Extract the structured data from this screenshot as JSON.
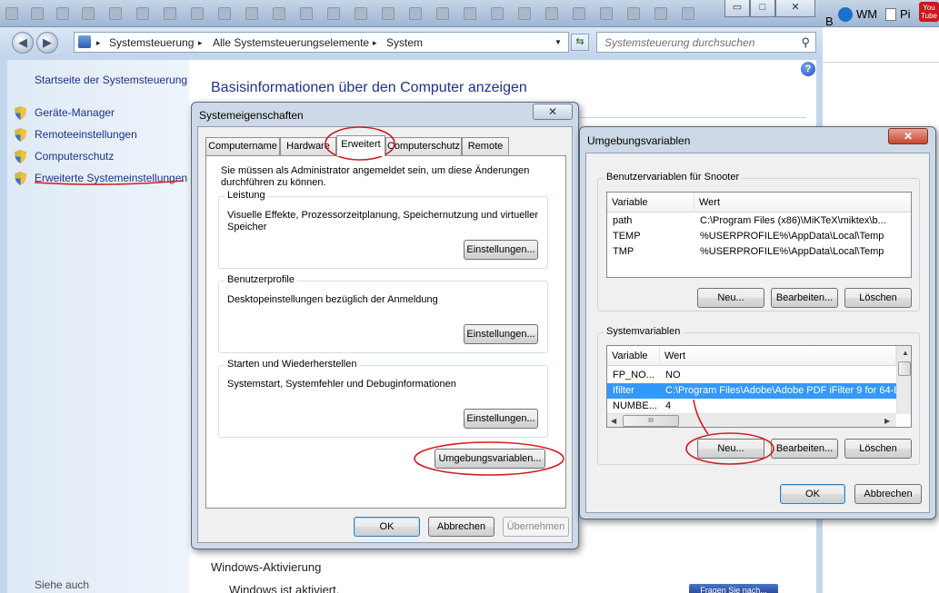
{
  "taskbar": {
    "right_items": [
      "B",
      "WM",
      "Pi",
      "You Tube"
    ]
  },
  "window": {
    "controls": {
      "minimize": "▭",
      "maximize": "□",
      "close": "✕"
    }
  },
  "navbar": {
    "back_icon": "◀",
    "forward_icon": "▶",
    "breadcrumb": [
      "Systemsteuerung",
      "Alle Systemsteuerungselemente",
      "System"
    ],
    "breadcrumb_sep": "▸",
    "search_placeholder": "Systemsteuerung durchsuchen"
  },
  "sidebar": {
    "home": "Startseite der Systemsteuerung",
    "items": [
      {
        "label": "Geräte-Manager"
      },
      {
        "label": "Remoteeinstellungen"
      },
      {
        "label": "Computerschutz"
      },
      {
        "label": "Erweiterte Systemeinstellungen"
      }
    ],
    "see_also": "Siehe auch"
  },
  "content": {
    "headline": "Basisinformationen über den Computer anzeigen",
    "help": "?",
    "activation_heading": "Windows-Aktivierung",
    "activation_status": "Windows ist aktiviert.",
    "fragen_button": "Fragen Sie nach..."
  },
  "sysprops": {
    "title": "Systemeigenschaften",
    "close": "✕",
    "tabs": [
      "Computername",
      "Hardware",
      "Erweitert",
      "Computerschutz",
      "Remote"
    ],
    "active_tab": "Erweitert",
    "admin_note": "Sie müssen als Administrator angemeldet sein, um diese Änderungen durchführen zu können.",
    "groups": [
      {
        "title": "Leistung",
        "desc": "Visuelle Effekte, Prozessorzeitplanung, Speichernutzung und virtueller Speicher",
        "button": "Einstellungen..."
      },
      {
        "title": "Benutzerprofile",
        "desc": "Desktopeinstellungen bezüglich der Anmeldung",
        "button": "Einstellungen..."
      },
      {
        "title": "Starten und Wiederherstellen",
        "desc": "Systemstart, Systemfehler und Debuginformationen",
        "button": "Einstellungen..."
      }
    ],
    "env_button": "Umgebungsvariablen...",
    "ok": "OK",
    "cancel": "Abbrechen",
    "apply": "Übernehmen"
  },
  "envvars": {
    "title": "Umgebungsvariablen",
    "close": "✕",
    "user_group_title": "Benutzervariablen für Snooter",
    "columns": [
      "Variable",
      "Wert"
    ],
    "user_vars": [
      {
        "name": "path",
        "value": "C:\\Program Files (x86)\\MiKTeX\\miktex\\b..."
      },
      {
        "name": "TEMP",
        "value": "%USERPROFILE%\\AppData\\Local\\Temp"
      },
      {
        "name": "TMP",
        "value": "%USERPROFILE%\\AppData\\Local\\Temp"
      }
    ],
    "user_buttons": {
      "new": "Neu...",
      "edit": "Bearbeiten...",
      "delete": "Löschen"
    },
    "system_group_title": "Systemvariablen",
    "system_vars": [
      {
        "name": "FP_NO...",
        "value": "NO"
      },
      {
        "name": "Ifilter",
        "value": "C:\\Program Files\\Adobe\\Adobe PDF iFilter 9 for 64-b"
      },
      {
        "name": "NUMBE...",
        "value": "4"
      }
    ],
    "selected_system_row": 1,
    "hscroll_thumb": "III",
    "system_buttons": {
      "new": "Neu...",
      "edit": "Bearbeiten...",
      "delete": "Löschen"
    },
    "ok": "OK",
    "cancel": "Abbrechen"
  },
  "colors": {
    "link": "#1e3287",
    "annotation_red": "#d21e1e",
    "selection": "#3399ff"
  }
}
